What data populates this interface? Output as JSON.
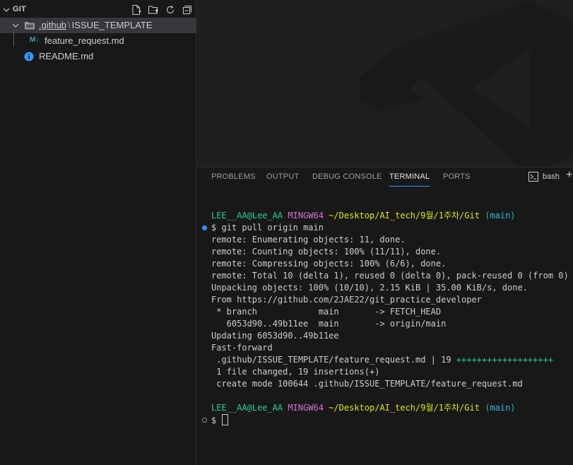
{
  "sidebar": {
    "section_title": "GIT",
    "tree": {
      "folder_part1": ".github",
      "folder_sep": "\\",
      "folder_part2": "ISSUE_TEMPLATE",
      "file1_badge": "M↓",
      "file1": "feature_request.md",
      "file2": "README.md"
    },
    "icons": [
      "new-file-icon",
      "new-folder-icon",
      "refresh-icon",
      "collapse-all-icon"
    ]
  },
  "panel": {
    "tabs": [
      "PROBLEMS",
      "OUTPUT",
      "DEBUG CONSOLE",
      "TERMINAL",
      "PORTS"
    ],
    "active_tab": "TERMINAL",
    "shell_label": "bash",
    "add_label": "+"
  },
  "terminal": {
    "user": "LEE__AA@Lee_AA",
    "system": "MINGW64",
    "path": "~/Desktop/AI_tech/9월/1주차/Git",
    "branch": "(main)",
    "prompt": "$",
    "command": "git pull origin main",
    "output": [
      "remote: Enumerating objects: 11, done.",
      "remote: Counting objects: 100% (11/11), done.",
      "remote: Compressing objects: 100% (6/6), done.",
      "remote: Total 10 (delta 1), reused 0 (delta 0), pack-reused 0 (from 0)",
      "Unpacking objects: 100% (10/10), 2.15 KiB | 35.00 KiB/s, done.",
      "From https://github.com/2JAE22/git_practice_developer",
      " * branch            main       -> FETCH_HEAD",
      "   6053d90..49b11ee  main       -> origin/main",
      "Updating 6053d90..49b11ee",
      "Fast-forward"
    ],
    "diffstat_file": " .github/ISSUE_TEMPLATE/feature_request.md | 19 ",
    "diffstat_plus": "+++++++++++++++++++",
    "summary": [
      " 1 file changed, 19 insertions(+)",
      " create mode 100644 .github/ISSUE_TEMPLATE/feature_request.md"
    ]
  },
  "colors": {
    "accent": "#3794ff",
    "green": "#23d18b",
    "magenta": "#d670d6",
    "yellow": "#e5e510",
    "cyan": "#29b8db"
  }
}
